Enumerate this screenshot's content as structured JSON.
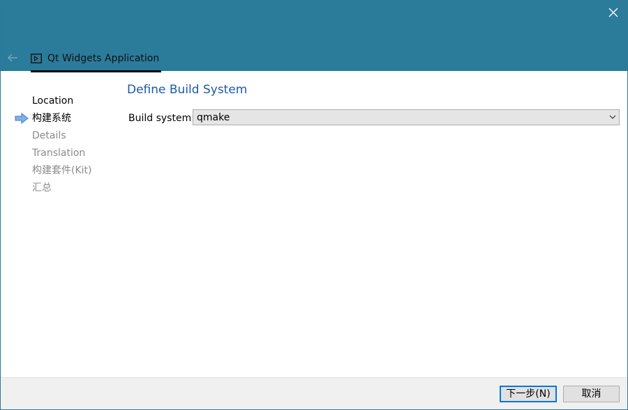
{
  "window": {
    "tab_title": "Qt Widgets Application",
    "close_icon": "close-icon",
    "back_icon": "back-arrow-icon",
    "accent_color": "#2b7b9b"
  },
  "steps": [
    {
      "label": "Location",
      "state": "done"
    },
    {
      "label": "构建系统",
      "state": "current"
    },
    {
      "label": "Details",
      "state": "pending"
    },
    {
      "label": "Translation",
      "state": "pending"
    },
    {
      "label": "构建套件(Kit)",
      "state": "pending"
    },
    {
      "label": "汇总",
      "state": "pending"
    }
  ],
  "page": {
    "title": "Define Build System",
    "build_system_label": "Build system:",
    "build_system_value": "qmake"
  },
  "footer": {
    "next_label": "下一步(N)",
    "cancel_label": "取消"
  }
}
